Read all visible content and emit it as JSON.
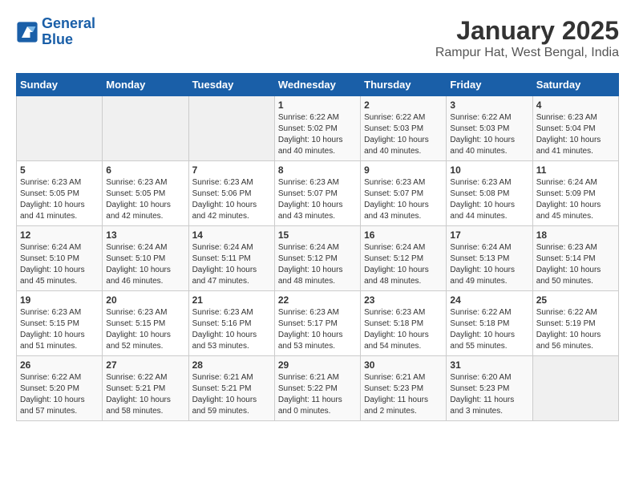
{
  "header": {
    "logo_line1": "General",
    "logo_line2": "Blue",
    "main_title": "January 2025",
    "subtitle": "Rampur Hat, West Bengal, India"
  },
  "weekdays": [
    "Sunday",
    "Monday",
    "Tuesday",
    "Wednesday",
    "Thursday",
    "Friday",
    "Saturday"
  ],
  "weeks": [
    [
      {
        "day": "",
        "empty": true
      },
      {
        "day": "",
        "empty": true
      },
      {
        "day": "",
        "empty": true
      },
      {
        "day": "1",
        "sunrise": "6:22 AM",
        "sunset": "5:02 PM",
        "daylight": "10 hours and 40 minutes."
      },
      {
        "day": "2",
        "sunrise": "6:22 AM",
        "sunset": "5:03 PM",
        "daylight": "10 hours and 40 minutes."
      },
      {
        "day": "3",
        "sunrise": "6:22 AM",
        "sunset": "5:03 PM",
        "daylight": "10 hours and 40 minutes."
      },
      {
        "day": "4",
        "sunrise": "6:23 AM",
        "sunset": "5:04 PM",
        "daylight": "10 hours and 41 minutes."
      }
    ],
    [
      {
        "day": "5",
        "sunrise": "6:23 AM",
        "sunset": "5:05 PM",
        "daylight": "10 hours and 41 minutes."
      },
      {
        "day": "6",
        "sunrise": "6:23 AM",
        "sunset": "5:05 PM",
        "daylight": "10 hours and 42 minutes."
      },
      {
        "day": "7",
        "sunrise": "6:23 AM",
        "sunset": "5:06 PM",
        "daylight": "10 hours and 42 minutes."
      },
      {
        "day": "8",
        "sunrise": "6:23 AM",
        "sunset": "5:07 PM",
        "daylight": "10 hours and 43 minutes."
      },
      {
        "day": "9",
        "sunrise": "6:23 AM",
        "sunset": "5:07 PM",
        "daylight": "10 hours and 43 minutes."
      },
      {
        "day": "10",
        "sunrise": "6:23 AM",
        "sunset": "5:08 PM",
        "daylight": "10 hours and 44 minutes."
      },
      {
        "day": "11",
        "sunrise": "6:24 AM",
        "sunset": "5:09 PM",
        "daylight": "10 hours and 45 minutes."
      }
    ],
    [
      {
        "day": "12",
        "sunrise": "6:24 AM",
        "sunset": "5:10 PM",
        "daylight": "10 hours and 45 minutes."
      },
      {
        "day": "13",
        "sunrise": "6:24 AM",
        "sunset": "5:10 PM",
        "daylight": "10 hours and 46 minutes."
      },
      {
        "day": "14",
        "sunrise": "6:24 AM",
        "sunset": "5:11 PM",
        "daylight": "10 hours and 47 minutes."
      },
      {
        "day": "15",
        "sunrise": "6:24 AM",
        "sunset": "5:12 PM",
        "daylight": "10 hours and 48 minutes."
      },
      {
        "day": "16",
        "sunrise": "6:24 AM",
        "sunset": "5:12 PM",
        "daylight": "10 hours and 48 minutes."
      },
      {
        "day": "17",
        "sunrise": "6:24 AM",
        "sunset": "5:13 PM",
        "daylight": "10 hours and 49 minutes."
      },
      {
        "day": "18",
        "sunrise": "6:23 AM",
        "sunset": "5:14 PM",
        "daylight": "10 hours and 50 minutes."
      }
    ],
    [
      {
        "day": "19",
        "sunrise": "6:23 AM",
        "sunset": "5:15 PM",
        "daylight": "10 hours and 51 minutes."
      },
      {
        "day": "20",
        "sunrise": "6:23 AM",
        "sunset": "5:15 PM",
        "daylight": "10 hours and 52 minutes."
      },
      {
        "day": "21",
        "sunrise": "6:23 AM",
        "sunset": "5:16 PM",
        "daylight": "10 hours and 53 minutes."
      },
      {
        "day": "22",
        "sunrise": "6:23 AM",
        "sunset": "5:17 PM",
        "daylight": "10 hours and 53 minutes."
      },
      {
        "day": "23",
        "sunrise": "6:23 AM",
        "sunset": "5:18 PM",
        "daylight": "10 hours and 54 minutes."
      },
      {
        "day": "24",
        "sunrise": "6:22 AM",
        "sunset": "5:18 PM",
        "daylight": "10 hours and 55 minutes."
      },
      {
        "day": "25",
        "sunrise": "6:22 AM",
        "sunset": "5:19 PM",
        "daylight": "10 hours and 56 minutes."
      }
    ],
    [
      {
        "day": "26",
        "sunrise": "6:22 AM",
        "sunset": "5:20 PM",
        "daylight": "10 hours and 57 minutes."
      },
      {
        "day": "27",
        "sunrise": "6:22 AM",
        "sunset": "5:21 PM",
        "daylight": "10 hours and 58 minutes."
      },
      {
        "day": "28",
        "sunrise": "6:21 AM",
        "sunset": "5:21 PM",
        "daylight": "10 hours and 59 minutes."
      },
      {
        "day": "29",
        "sunrise": "6:21 AM",
        "sunset": "5:22 PM",
        "daylight": "11 hours and 0 minutes."
      },
      {
        "day": "30",
        "sunrise": "6:21 AM",
        "sunset": "5:23 PM",
        "daylight": "11 hours and 2 minutes."
      },
      {
        "day": "31",
        "sunrise": "6:20 AM",
        "sunset": "5:23 PM",
        "daylight": "11 hours and 3 minutes."
      },
      {
        "day": "",
        "empty": true
      }
    ]
  ],
  "labels": {
    "sunrise_label": "Sunrise:",
    "sunset_label": "Sunset:",
    "daylight_label": "Daylight:"
  }
}
